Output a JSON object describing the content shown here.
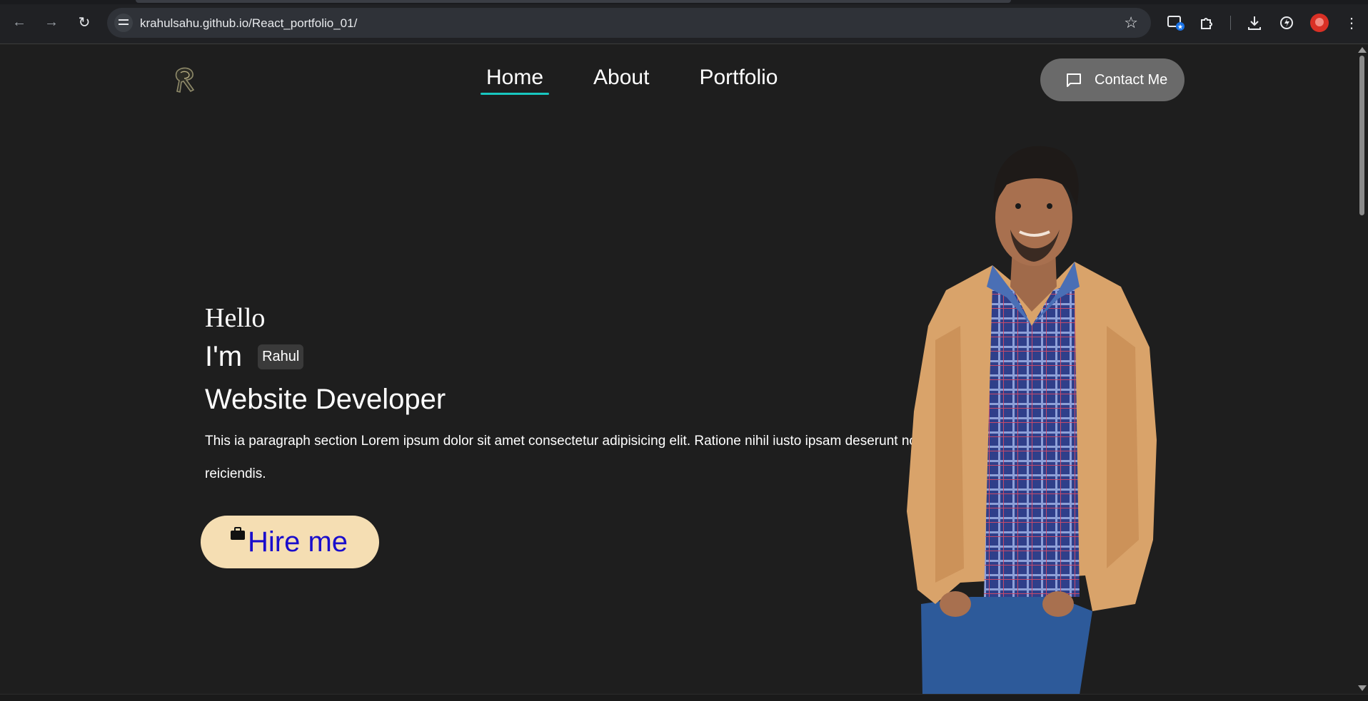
{
  "browser": {
    "url": "krahulsahu.github.io/React_portfolio_01/",
    "icons": [
      "back-arrow-icon",
      "forward-arrow-icon",
      "reload-icon",
      "site-info-icon",
      "bookmark-star-icon",
      "tab-search-icon",
      "extensions-icon",
      "downloads-icon",
      "performance-icon",
      "profile-avatar",
      "more-menu-icon"
    ]
  },
  "site": {
    "nav": {
      "links": [
        {
          "label": "Home",
          "current": true
        },
        {
          "label": "About",
          "current": false
        },
        {
          "label": "Portfolio",
          "current": false
        }
      ],
      "contact_label": "Contact Me",
      "accent_color": "#18c7c0"
    },
    "hero": {
      "greeting": "Hello",
      "im": "I'm",
      "name": "Rahul",
      "role": "Website Developer",
      "paragraph": "This ia paragraph section Lorem ipsum dolor sit amet consectetur adipisicing elit. Ratione nihil iusto ipsam deserunt nostrum reiciendis.",
      "hire_label": "Hire me"
    },
    "colors": {
      "background": "#1e1e1e",
      "hire_button_bg": "#f5deb3",
      "hire_button_text": "#1a0dcc",
      "contact_button_bg": "#6a6a6a"
    }
  }
}
